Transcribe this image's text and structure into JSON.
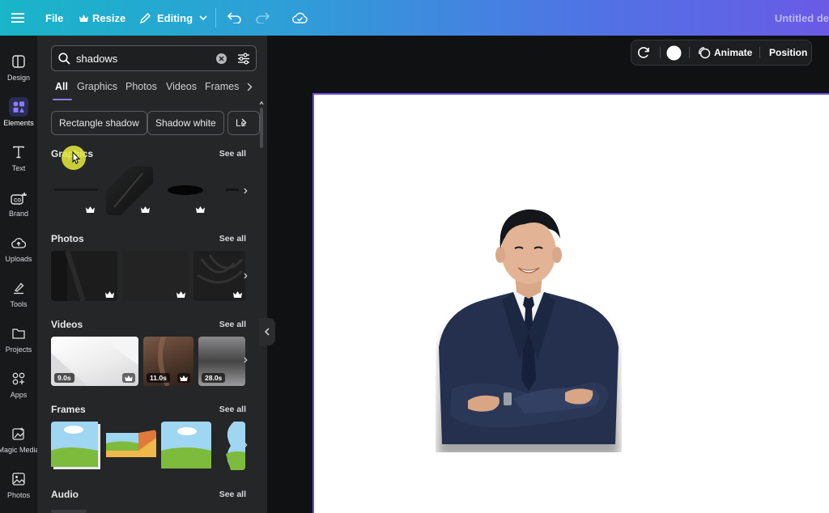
{
  "topbar": {
    "menu_icon": "hamburger-icon",
    "file_label": "File",
    "resize_label": "Resize",
    "editing_label": "Editing",
    "doc_title": "Untitled de"
  },
  "rail": {
    "items": [
      {
        "label": "Design",
        "icon": "design-icon"
      },
      {
        "label": "Elements",
        "icon": "elements-icon",
        "active": true
      },
      {
        "label": "Text",
        "icon": "text-icon"
      },
      {
        "label": "Brand",
        "icon": "brand-icon"
      },
      {
        "label": "Uploads",
        "icon": "uploads-icon"
      },
      {
        "label": "Tools",
        "icon": "tools-icon"
      },
      {
        "label": "Projects",
        "icon": "projects-icon"
      },
      {
        "label": "Apps",
        "icon": "apps-icon"
      },
      {
        "label": "Magic Media",
        "icon": "magic-media-icon"
      },
      {
        "label": "Photos",
        "icon": "photos-icon"
      }
    ]
  },
  "search": {
    "value": "shadows"
  },
  "tabs": [
    {
      "label": "All",
      "active": true
    },
    {
      "label": "Graphics"
    },
    {
      "label": "Photos"
    },
    {
      "label": "Videos"
    },
    {
      "label": "Frames"
    }
  ],
  "chips": [
    "Rectangle shadow",
    "Shadow white",
    "Le"
  ],
  "sections": {
    "graphics": {
      "title": "Graphics",
      "see_all": "See all"
    },
    "photos": {
      "title": "Photos",
      "see_all": "See all"
    },
    "videos": {
      "title": "Videos",
      "see_all": "See all",
      "items": [
        {
          "duration": "9.0s"
        },
        {
          "duration": "11.0s"
        },
        {
          "duration": "28.0s"
        }
      ]
    },
    "frames": {
      "title": "Frames",
      "see_all": "See all"
    },
    "audio": {
      "title": "Audio",
      "see_all": "See all"
    }
  },
  "context_bar": {
    "animate_label": "Animate",
    "position_label": "Position"
  },
  "colors": {
    "accent": "#8b7cf6",
    "page_border": "#6b4ce6",
    "suit": "#1f2a44"
  }
}
